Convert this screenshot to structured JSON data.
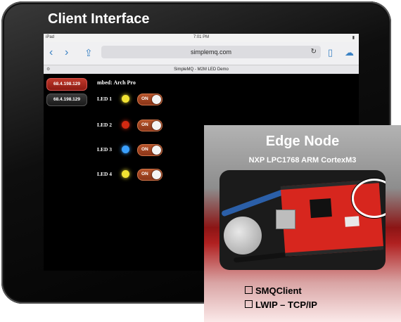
{
  "frame": {
    "title": "Client Interface"
  },
  "statusbar": {
    "device": "iPad",
    "time": "7:01 PM"
  },
  "browser": {
    "url": "simplemq.com",
    "page_title": "SimpleMQ - M2M LED Demo"
  },
  "ip_buttons": [
    "68.4.198.129",
    "68.4.198.129"
  ],
  "device_name": "mbed: Arch Pro",
  "leds": [
    {
      "label": "LED 1",
      "color": "#f1e233",
      "state": "ON"
    },
    {
      "label": "LED 2",
      "color": "#d22a12",
      "state": "ON"
    },
    {
      "label": "LED 3",
      "color": "#3aa0ff",
      "state": "ON"
    },
    {
      "label": "LED 4",
      "color": "#f1e233",
      "state": "ON"
    }
  ],
  "edge": {
    "title": "Edge Node",
    "subtitle": "NXP LPC1768 ARM CortexM3",
    "features": [
      "SMQClient",
      "LWIP – TCP/IP"
    ]
  }
}
